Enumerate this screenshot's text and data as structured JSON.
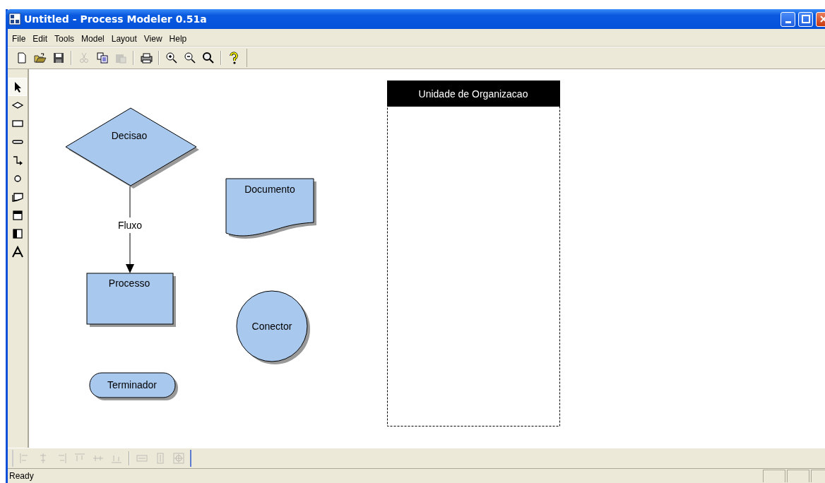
{
  "window": {
    "title": "Untitled - Process Modeler 0.51a"
  },
  "menu": [
    {
      "label": "File"
    },
    {
      "label": "Edit"
    },
    {
      "label": "Tools"
    },
    {
      "label": "Model"
    },
    {
      "label": "Layout"
    },
    {
      "label": "View"
    },
    {
      "label": "Help"
    }
  ],
  "toolbar": [
    {
      "kind": "new",
      "disabled": false
    },
    {
      "kind": "open",
      "disabled": false
    },
    {
      "kind": "save",
      "disabled": false
    },
    {
      "kind": "sep"
    },
    {
      "kind": "cut",
      "disabled": true
    },
    {
      "kind": "copy",
      "disabled": false
    },
    {
      "kind": "paste",
      "disabled": true
    },
    {
      "kind": "sep"
    },
    {
      "kind": "print",
      "disabled": false
    },
    {
      "kind": "sep"
    },
    {
      "kind": "zoom-in",
      "disabled": false
    },
    {
      "kind": "zoom-out",
      "disabled": false
    },
    {
      "kind": "zoom",
      "disabled": false
    },
    {
      "kind": "sep"
    },
    {
      "kind": "help",
      "disabled": false
    }
  ],
  "palette": [
    {
      "kind": "pointer",
      "selected": true
    },
    {
      "kind": "decision",
      "selected": false
    },
    {
      "kind": "process",
      "selected": false
    },
    {
      "kind": "terminator",
      "selected": false
    },
    {
      "kind": "flow",
      "selected": false
    },
    {
      "kind": "connector",
      "selected": false
    },
    {
      "kind": "document",
      "selected": false
    },
    {
      "kind": "lane-h",
      "selected": false
    },
    {
      "kind": "lane-v",
      "selected": false
    },
    {
      "kind": "text",
      "selected": false
    }
  ],
  "diagram": {
    "nodes": [
      {
        "kind": "decision",
        "label": "Decisao"
      },
      {
        "kind": "process",
        "label": "Processo"
      },
      {
        "kind": "terminator",
        "label": "Terminador"
      },
      {
        "kind": "document",
        "label": "Documento"
      },
      {
        "kind": "connector",
        "label": "Conector"
      },
      {
        "kind": "lane",
        "label": "Unidade de Organizacao"
      }
    ],
    "edges": [
      {
        "label": "Fluxo"
      }
    ]
  },
  "layout_toolbar": [
    {
      "kind": "align-left"
    },
    {
      "kind": "align-center"
    },
    {
      "kind": "align-right"
    },
    {
      "kind": "align-top"
    },
    {
      "kind": "align-middle"
    },
    {
      "kind": "align-bottom"
    },
    {
      "kind": "sep"
    },
    {
      "kind": "same-width"
    },
    {
      "kind": "same-height"
    },
    {
      "kind": "center"
    }
  ],
  "status_bar": {
    "text": "Ready"
  }
}
